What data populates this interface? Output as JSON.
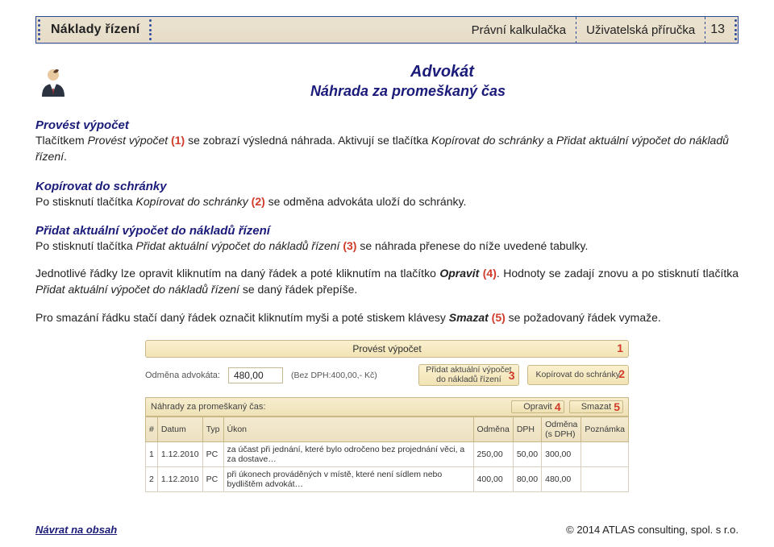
{
  "banner": {
    "left": "Náklady řízení",
    "mid": "Právní kalkulačka",
    "right": "Uživatelská příručka",
    "page": "13"
  },
  "header": {
    "line1": "Advokát",
    "line2": "Náhrada za promeškaný čas"
  },
  "sections": {
    "s1": {
      "title": "Provést výpočet",
      "p1a": "Tlačítkem ",
      "p1b": "Provést výpočet",
      "p1c": " (1)",
      "p1d": " se zobrazí výsledná náhrada. Aktivují se tlačítka  ",
      "p1e": "Kopírovat do schránky",
      "p1f": " a ",
      "p1g": "Přidat aktuální výpočet do nákladů řízení",
      "p1h": "."
    },
    "s2": {
      "title": "Kopírovat do schránky",
      "p1a": "Po stisknutí tlačítka ",
      "p1b": "Kopírovat do schránky",
      "p1c": " (2)",
      "p1d": " se odměna advokáta uloží do schránky."
    },
    "s3": {
      "title": "Přidat aktuální výpočet do nákladů řízení",
      "p1a": "Po stisknutí tlačítka ",
      "p1b": "Přidat aktuální výpočet do nákladů řízení",
      "p1c": " (3)",
      "p1d": " se náhrada přenese do níže uvedené tabulky."
    },
    "p4a": "Jednotlivé řádky lze opravit kliknutím na daný řádek a poté kliknutím na tlačítko ",
    "p4b": "Opravit",
    "p4c": " (4)",
    "p4d": ". Hodnoty se zadají znovu a po stisknutí tlačítka ",
    "p4e": "Přidat aktuální výpočet do nákladů řízení",
    "p4f": " se daný řádek přepíše.",
    "p5a": "Pro smazání řádku stačí daný řádek označit kliknutím myši a poté stiskem klávesy ",
    "p5b": "Smazat",
    "p5c": " (5)",
    "p5d": " se požadovaný řádek vymaže."
  },
  "screenshot": {
    "btn_calc": "Provést výpočet",
    "lbl_odmena": "Odměna advokáta:",
    "val_odmena": "480,00",
    "val_bezdph": "(Bez DPH:400,00,- Kč)",
    "btn_add1": "Přidat aktuální výpočet",
    "btn_add2": "do nákladů řízení",
    "btn_copy": "Kopírovat do schránky",
    "bar_title": "Náhrady za promeškaný čas:",
    "btn_edit": "Opravit",
    "btn_del": "Smazat",
    "anno": {
      "a1": "1",
      "a2": "2",
      "a3": "3",
      "a4": "4",
      "a5": "5"
    },
    "table": {
      "headers": [
        "#",
        "Datum",
        "Typ",
        "Úkon",
        "Odměna",
        "DPH",
        "Odměna (s DPH)",
        "Poznámka"
      ],
      "rows": [
        [
          "1",
          "1.12.2010",
          "PC",
          "za účast při jednání, které bylo odročeno bez projednání věci, a za dostave…",
          "250,00",
          "50,00",
          "300,00",
          ""
        ],
        [
          "2",
          "1.12.2010",
          "PC",
          "při úkonech prováděných v místě, které není sídlem nebo bydlištěm advokát…",
          "400,00",
          "80,00",
          "480,00",
          ""
        ]
      ]
    }
  },
  "footer": {
    "back": "Návrat na obsah",
    "copyright": "© 2014 ATLAS consulting, spol. s r.o."
  }
}
